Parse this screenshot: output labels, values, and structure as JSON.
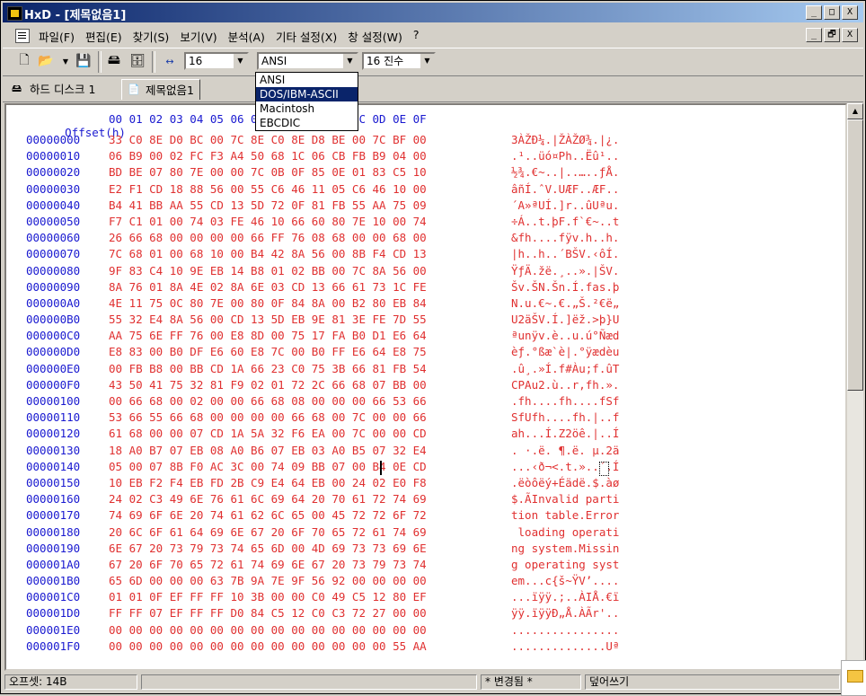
{
  "window": {
    "title": "HxD - [제목없음1]",
    "controls": [
      "_",
      "□",
      "X"
    ],
    "mdi_controls": [
      "_",
      "🗗",
      "X"
    ]
  },
  "menu": [
    "파일(F)",
    "편집(E)",
    "찾기(S)",
    "보기(V)",
    "분석(A)",
    "기타 설정(X)",
    "창 설정(W)",
    "?"
  ],
  "toolbar": {
    "bytes_per_row": "16",
    "charset": "ANSI",
    "offset_base": "16 진수",
    "charset_options": [
      "ANSI",
      "DOS/IBM-ASCII",
      "Macintosh",
      "EBCDIC"
    ],
    "charset_highlighted": "DOS/IBM-ASCII"
  },
  "tabs": [
    "하드 디스크 1",
    "제목없음1"
  ],
  "editor": {
    "offset_label": "Offset(h)",
    "column_header": "00 01 02 03 04 05 06 07 08 09 0A 0B 0C 0D 0E 0F",
    "rows": [
      {
        "offset": "00000000",
        "hex": "33 C0 8E D0 BC 00 7C 8E C0 8E D8 BE 00 7C BF 00",
        "ascii": "3ÀŽÐ¼.|ŽÀŽØ¾.|¿."
      },
      {
        "offset": "00000010",
        "hex": "06 B9 00 02 FC F3 A4 50 68 1C 06 CB FB B9 04 00",
        "ascii": ".¹..üó¤Ph..Ëû¹.."
      },
      {
        "offset": "00000020",
        "hex": "BD BE 07 80 7E 00 00 7C 0B 0F 85 0E 01 83 C5 10",
        "ascii": "½¾.€~..|..…..ƒÅ."
      },
      {
        "offset": "00000030",
        "hex": "E2 F1 CD 18 88 56 00 55 C6 46 11 05 C6 46 10 00",
        "ascii": "âñÍ.ˆV.UÆF..ÆF.."
      },
      {
        "offset": "00000040",
        "hex": "B4 41 BB AA 55 CD 13 5D 72 0F 81 FB 55 AA 75 09",
        "ascii": "´A»ªUÍ.]r..ûUªu."
      },
      {
        "offset": "00000050",
        "hex": "F7 C1 01 00 74 03 FE 46 10 66 60 80 7E 10 00 74",
        "ascii": "÷Á..t.þF.f`€~..t"
      },
      {
        "offset": "00000060",
        "hex": "26 66 68 00 00 00 00 66 FF 76 08 68 00 00 68 00",
        "ascii": "&fh....fÿv.h..h."
      },
      {
        "offset": "00000070",
        "hex": "7C 68 01 00 68 10 00 B4 42 8A 56 00 8B F4 CD 13",
        "ascii": "|h..h..´BŠV.‹ôÍ."
      },
      {
        "offset": "00000080",
        "hex": "9F 83 C4 10 9E EB 14 B8 01 02 BB 00 7C 8A 56 00",
        "ascii": "ŸƒÄ.žë.¸..».|ŠV."
      },
      {
        "offset": "00000090",
        "hex": "8A 76 01 8A 4E 02 8A 6E 03 CD 13 66 61 73 1C FE",
        "ascii": "Šv.ŠN.Šn.Í.fas.þ"
      },
      {
        "offset": "000000A0",
        "hex": "4E 11 75 0C 80 7E 00 80 0F 84 8A 00 B2 80 EB 84",
        "ascii": "N.u.€~.€.„Š.²€ë„"
      },
      {
        "offset": "000000B0",
        "hex": "55 32 E4 8A 56 00 CD 13 5D EB 9E 81 3E FE 7D 55",
        "ascii": "U2äŠV.Í.]ëž.>þ}U"
      },
      {
        "offset": "000000C0",
        "hex": "AA 75 6E FF 76 00 E8 8D 00 75 17 FA B0 D1 E6 64",
        "ascii": "ªunÿv.è..u.ú°Ñæd"
      },
      {
        "offset": "000000D0",
        "hex": "E8 83 00 B0 DF E6 60 E8 7C 00 B0 FF E6 64 E8 75",
        "ascii": "èƒ.°ßæ`è|.°ÿædèu"
      },
      {
        "offset": "000000E0",
        "hex": "00 FB B8 00 BB CD 1A 66 23 C0 75 3B 66 81 FB 54",
        "ascii": ".û¸.»Í.f#Àu;f.ûT"
      },
      {
        "offset": "000000F0",
        "hex": "43 50 41 75 32 81 F9 02 01 72 2C 66 68 07 BB 00",
        "ascii": "CPAu2.ù..r,fh.»."
      },
      {
        "offset": "00000100",
        "hex": "00 66 68 00 02 00 00 66 68 08 00 00 00 66 53 66",
        "ascii": ".fh....fh....fSf"
      },
      {
        "offset": "00000110",
        "hex": "53 66 55 66 68 00 00 00 00 66 68 00 7C 00 00 66",
        "ascii": "SfUfh....fh.|..f"
      },
      {
        "offset": "00000120",
        "hex": "61 68 00 00 07 CD 1A 5A 32 F6 EA 00 7C 00 00 CD",
        "ascii": "ah...Í.Z2öê.|..Í"
      },
      {
        "offset": "00000130",
        "hex": "18 A0 B7 07 EB 08 A0 B6 07 EB 03 A0 B5 07 32 E4",
        "ascii": ". ·.ë. ¶.ë. µ.2ä"
      },
      {
        "offset": "00000140",
        "hex": "05 00 07 8B F0 AC 3C 00 74 09 BB 07 00 B4 0E CD",
        "ascii": "...‹ð¬<.t.»..´.Í"
      },
      {
        "offset": "00000150",
        "hex": "10 EB F2 F4 EB FD 2B C9 E4 64 EB 00 24 02 E0 F8",
        "ascii": ".ëòôëý+Éädë.$.àø"
      },
      {
        "offset": "00000160",
        "hex": "24 02 C3 49 6E 76 61 6C 69 64 20 70 61 72 74 69",
        "ascii": "$.ÃInvalid parti"
      },
      {
        "offset": "00000170",
        "hex": "74 69 6F 6E 20 74 61 62 6C 65 00 45 72 72 6F 72",
        "ascii": "tion table.Error"
      },
      {
        "offset": "00000180",
        "hex": "20 6C 6F 61 64 69 6E 67 20 6F 70 65 72 61 74 69",
        "ascii": " loading operati"
      },
      {
        "offset": "00000190",
        "hex": "6E 67 20 73 79 73 74 65 6D 00 4D 69 73 73 69 6E",
        "ascii": "ng system.Missin"
      },
      {
        "offset": "000001A0",
        "hex": "67 20 6F 70 65 72 61 74 69 6E 67 20 73 79 73 74",
        "ascii": "g operating syst"
      },
      {
        "offset": "000001B0",
        "hex": "65 6D 00 00 00 63 7B 9A 7E 9F 56 92 00 00 00 00",
        "ascii": "em...c{š~ŸV’...."
      },
      {
        "offset": "000001C0",
        "hex": "01 01 0F EF FF FF 10 3B 00 00 C0 49 C5 12 80 EF",
        "ascii": "...ïÿÿ.;..ÀIÅ.€ï"
      },
      {
        "offset": "000001D0",
        "hex": "FF FF 07 EF FF FF D0 84 C5 12 C0 C3 72 27 00 00",
        "ascii": "ÿÿ.ïÿÿÐ„Å.ÀÃr'.."
      },
      {
        "offset": "000001E0",
        "hex": "00 00 00 00 00 00 00 00 00 00 00 00 00 00 00 00",
        "ascii": "................"
      },
      {
        "offset": "000001F0",
        "hex": "00 00 00 00 00 00 00 00 00 00 00 00 00 00 55 AA",
        "ascii": "..............Uª"
      }
    ]
  },
  "status": {
    "offset": "오프셋: 14B",
    "modified": "* 변경됨 *",
    "mode": "덮어쓰기"
  }
}
